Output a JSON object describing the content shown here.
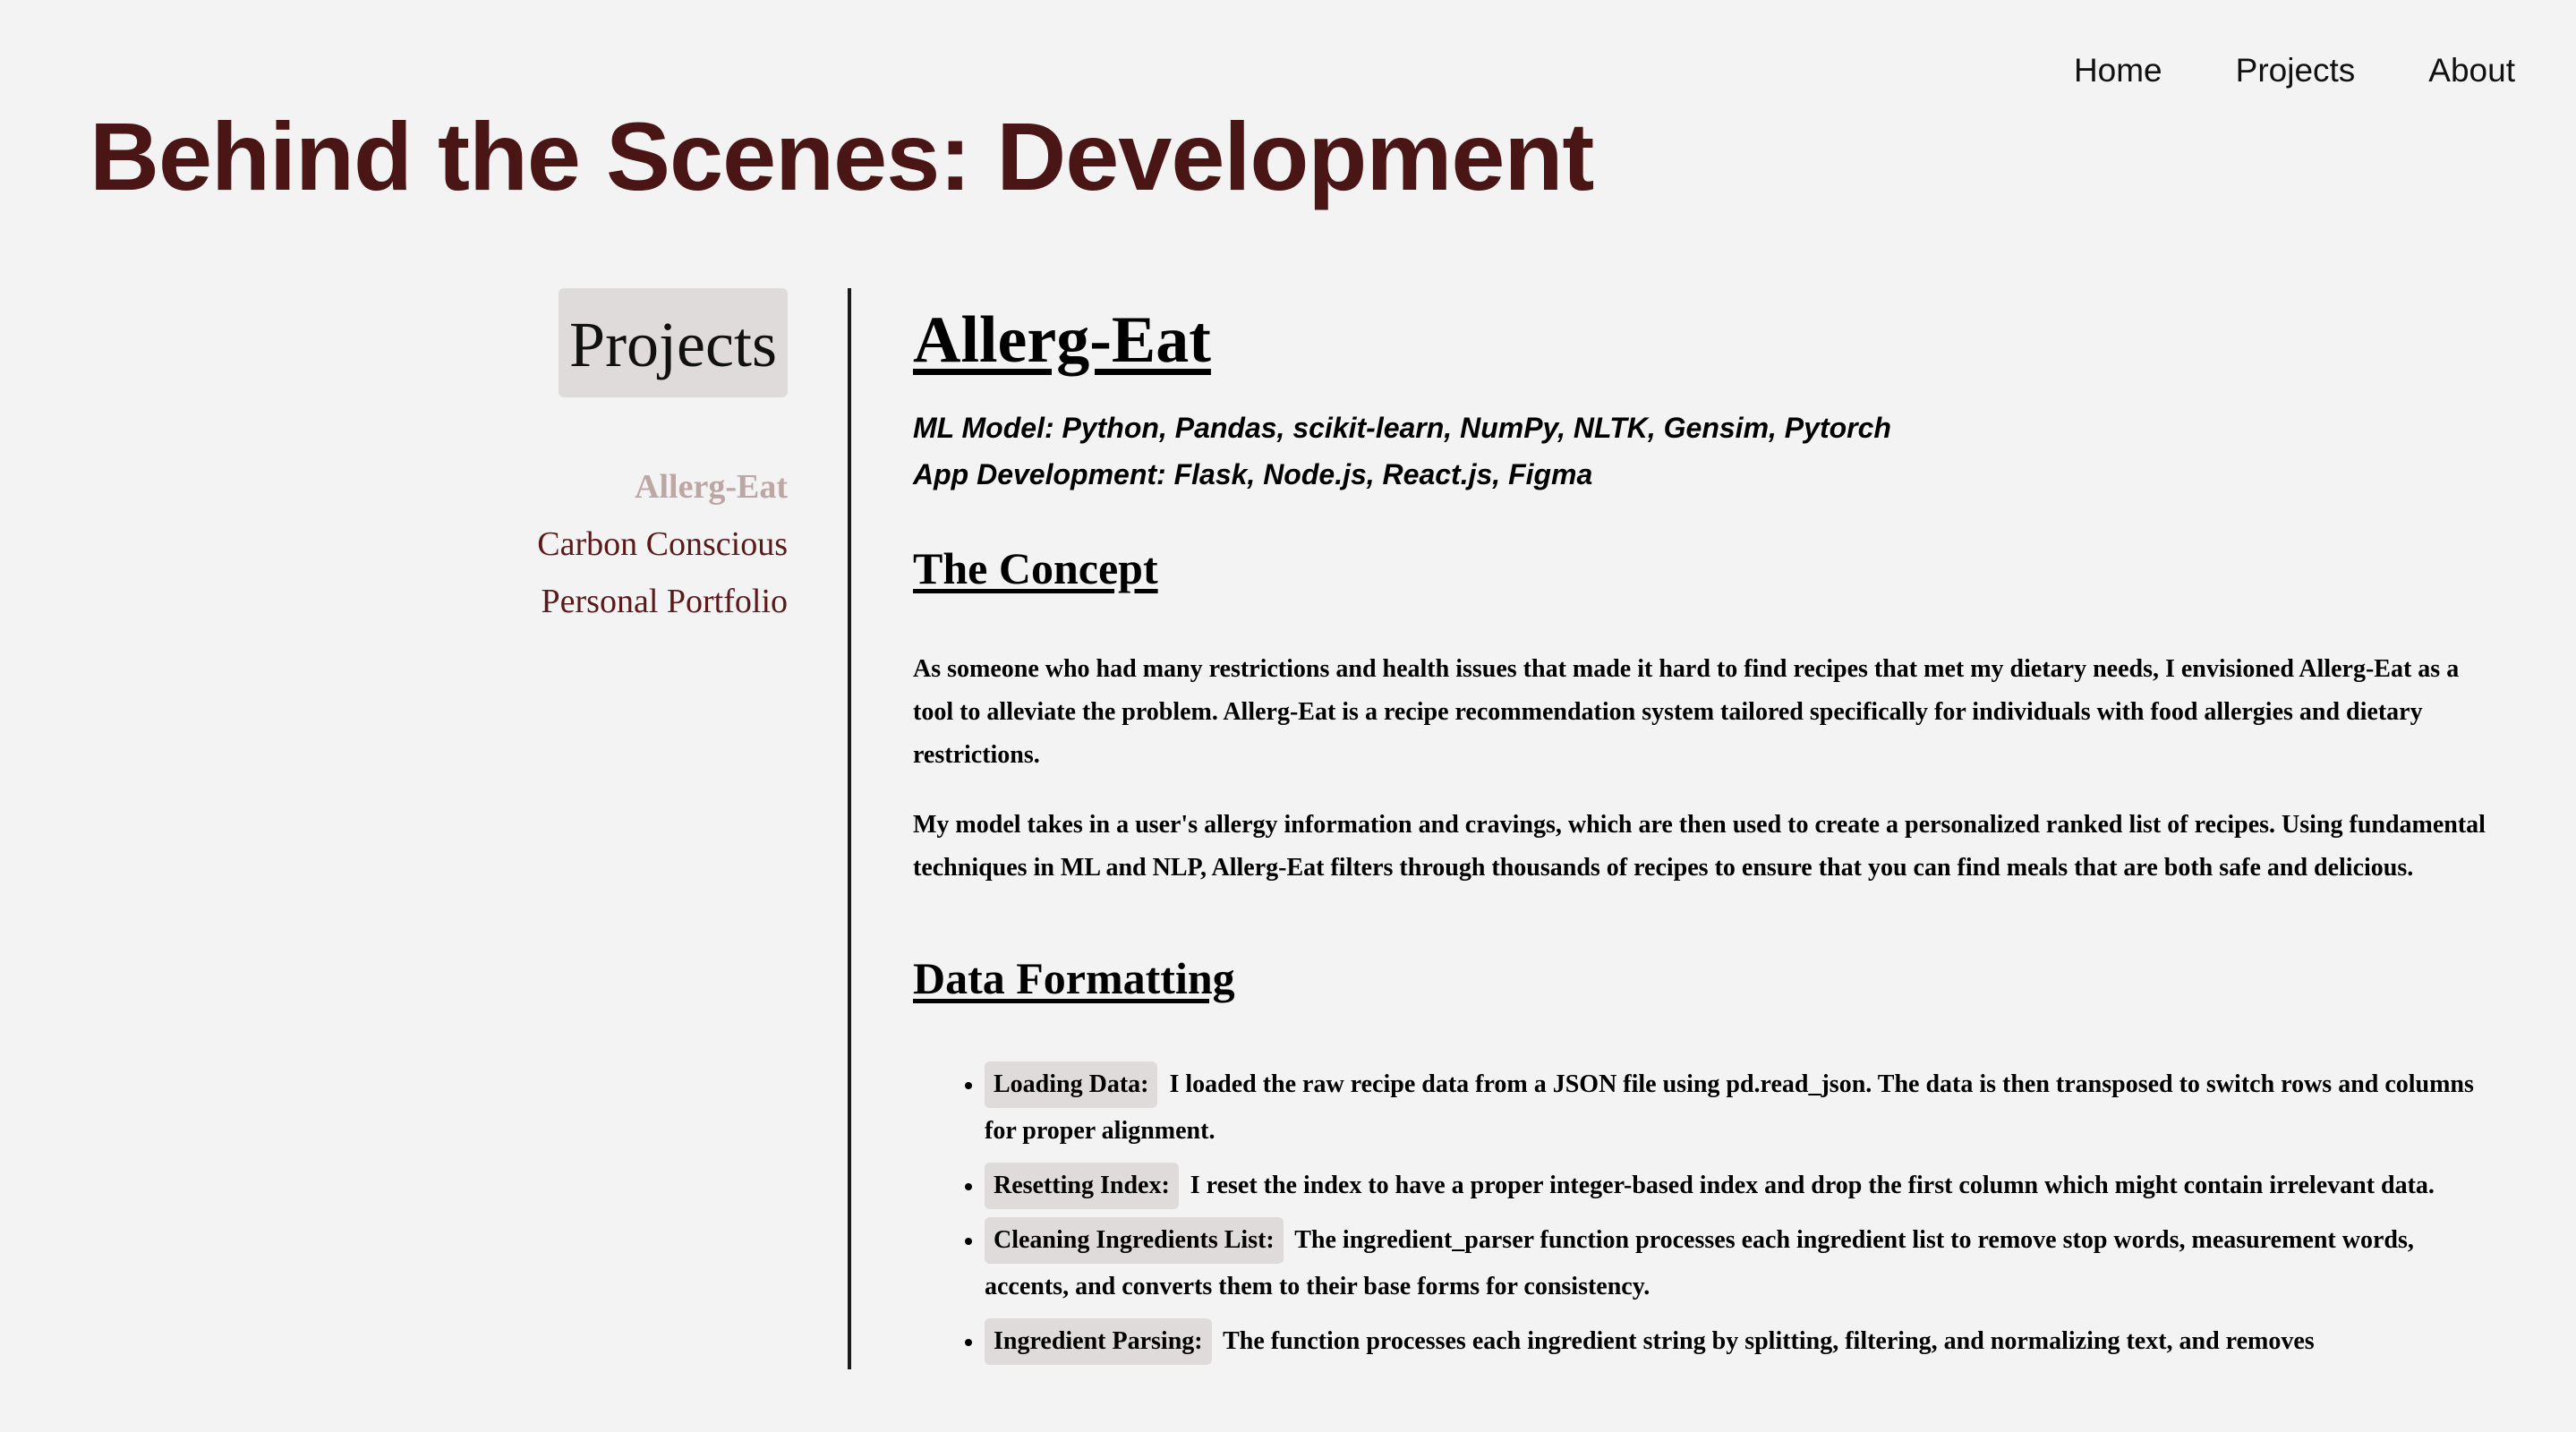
{
  "nav": {
    "links": [
      "Home",
      "Projects",
      "About"
    ]
  },
  "page": {
    "title": "Behind the Scenes: Development"
  },
  "sidebar": {
    "heading": "Projects",
    "items": [
      {
        "label": "Allerg-Eat",
        "active": true
      },
      {
        "label": "Carbon Conscious",
        "active": false
      },
      {
        "label": "Personal Portfolio",
        "active": false
      }
    ]
  },
  "project": {
    "title": "Allerg-Eat",
    "tech_ml": "ML Model: Python, Pandas, scikit-learn, NumPy, NLTK, Gensim, Pytorch",
    "tech_app": "App Development: Flask, Node.js, React.js, Figma",
    "concept": {
      "title": "The Concept",
      "paragraphs": [
        "As someone who had many restrictions and health issues that made it hard to find recipes that met my dietary needs, I envisioned Allerg-Eat as a tool to alleviate the problem. Allerg-Eat is a recipe recommendation system tailored specifically for individuals with food allergies and dietary restrictions.",
        "My model takes in a user's allergy information and cravings, which are then used to create a personalized ranked list of recipes. Using fundamental techniques in ML and NLP, Allerg-Eat filters through thousands of recipes to ensure that you can find meals that are both safe and delicious."
      ]
    },
    "formatting": {
      "title": "Data Formatting",
      "steps": [
        {
          "tag": "Loading Data:",
          "text": "I loaded the raw recipe data from a JSON file using pd.read_json. The data is then transposed to switch rows and columns for proper alignment."
        },
        {
          "tag": "Resetting Index:",
          "text": "I reset the index to have a proper integer-based index and drop the first column which might contain irrelevant data."
        },
        {
          "tag": "Cleaning Ingredients List:",
          "text": "The ingredient_parser function processes each ingredient list to remove stop words, measurement words, accents, and converts them to their base forms for consistency."
        },
        {
          "tag": "Ingredient Parsing:",
          "text": "The function processes each ingredient string by splitting, filtering, and normalizing text, and removes"
        }
      ]
    }
  },
  "colors": {
    "background": "#f3f3f3",
    "title": "#4a1515",
    "sidebar_link": "#5b1a1a",
    "sidebar_active": "#bca7a5",
    "tag_bg": "#dedbda"
  }
}
